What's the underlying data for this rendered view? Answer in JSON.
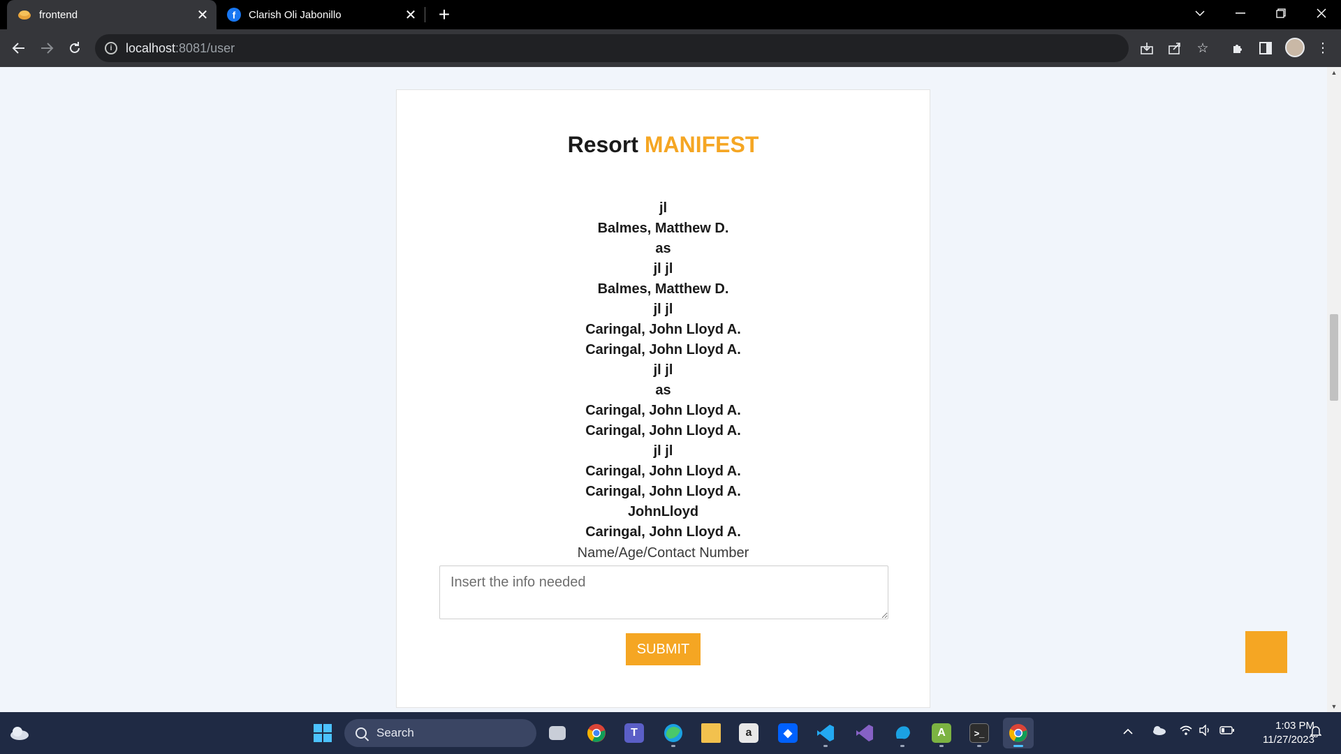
{
  "browser": {
    "tabs": [
      {
        "title": "frontend",
        "icon": "bread-favicon-icon",
        "active": true
      },
      {
        "title": "Clarish Oli Jabonillo",
        "icon": "facebook-icon",
        "active": false
      }
    ],
    "new_tab_glyph": "+",
    "url_host": "localhost",
    "url_path": ":8081/user"
  },
  "page": {
    "title_prefix": "Resort",
    "title_accent": "MANIFEST",
    "accent_color": "#f5a623",
    "entries": [
      "jl",
      "Balmes, Matthew D.",
      "as",
      "jl jl",
      "Balmes, Matthew D.",
      "jl jl",
      "Caringal, John Lloyd A.",
      "Caringal, John Lloyd A.",
      "jl jl",
      "as",
      "Caringal, John Lloyd A.",
      "Caringal, John Lloyd A.",
      "jl jl",
      "Caringal, John Lloyd A.",
      "Caringal, John Lloyd A.",
      "JohnLloyd",
      "Caringal, John Lloyd A."
    ],
    "field_label": "Name/Age/Contact Number",
    "field_placeholder": "Insert the info needed",
    "submit_label": "SUBMIT"
  },
  "taskbar": {
    "search_label": "Search",
    "time": "1:03 PM",
    "date": "11/27/2023"
  }
}
